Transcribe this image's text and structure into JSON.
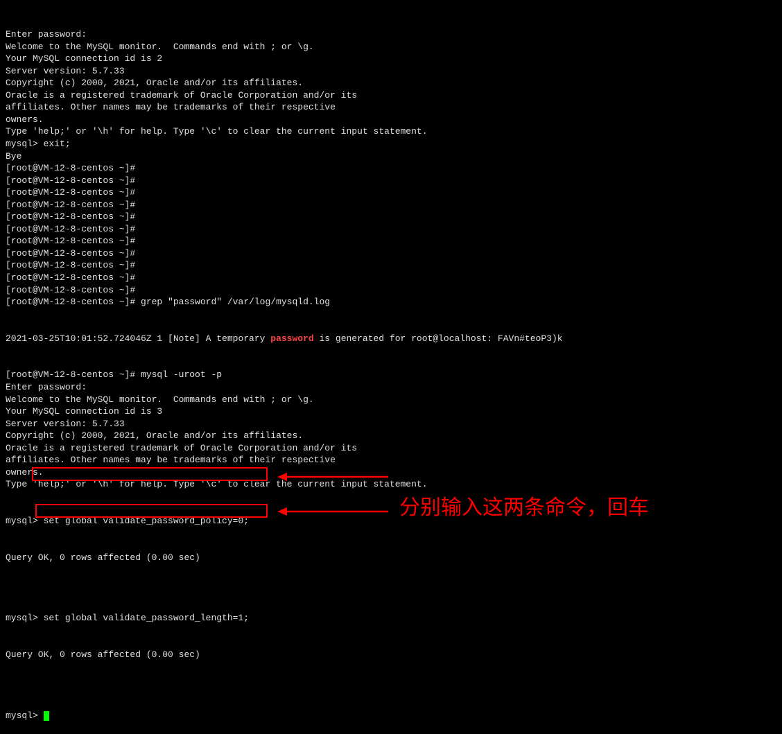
{
  "terminal": {
    "lines": [
      "Enter password:",
      "Welcome to the MySQL monitor.  Commands end with ; or \\g.",
      "Your MySQL connection id is 2",
      "Server version: 5.7.33",
      "",
      "Copyright (c) 2000, 2021, Oracle and/or its affiliates.",
      "",
      "Oracle is a registered trademark of Oracle Corporation and/or its",
      "affiliates. Other names may be trademarks of their respective",
      "owners.",
      "",
      "Type 'help;' or '\\h' for help. Type '\\c' to clear the current input statement.",
      "",
      "mysql> exit;",
      "Bye",
      "[root@VM-12-8-centos ~]#",
      "[root@VM-12-8-centos ~]#",
      "[root@VM-12-8-centos ~]#",
      "[root@VM-12-8-centos ~]#",
      "[root@VM-12-8-centos ~]#",
      "[root@VM-12-8-centos ~]#",
      "[root@VM-12-8-centos ~]#",
      "[root@VM-12-8-centos ~]#",
      "[root@VM-12-8-centos ~]#",
      "[root@VM-12-8-centos ~]#",
      "[root@VM-12-8-centos ~]#",
      "[root@VM-12-8-centos ~]# grep \"password\" /var/log/mysqld.log"
    ],
    "noteLinePrefix": "2021-03-25T10:01:52.724046Z 1 [Note] A temporary ",
    "noteLineHighlight": "password",
    "noteLineSuffix": " is generated for root@localhost: FAVn#teoP3)k",
    "lines2": [
      "[root@VM-12-8-centos ~]# mysql -uroot -p",
      "Enter password:",
      "Welcome to the MySQL monitor.  Commands end with ; or \\g.",
      "Your MySQL connection id is 3",
      "Server version: 5.7.33",
      "",
      "Copyright (c) 2000, 2021, Oracle and/or its affiliates.",
      "",
      "Oracle is a registered trademark of Oracle Corporation and/or its",
      "affiliates. Other names may be trademarks of their respective",
      "owners.",
      "",
      "Type 'help;' or '\\h' for help. Type '\\c' to clear the current input statement.",
      ""
    ],
    "cmd1Prompt": "mysql",
    "cmd1": "> set global validate_password_policy=0;",
    "result1": "Query OK, 0 rows affected (0.00 sec)",
    "blank": "",
    "cmd2Prompt": "mysql>",
    "cmd2": " set global validate_password_length=1;",
    "result2": "Query OK, 0 rows affected (0.00 sec)",
    "finalPrompt": "mysql> "
  },
  "annotation": {
    "text": "分别输入这两条命令，回车"
  }
}
